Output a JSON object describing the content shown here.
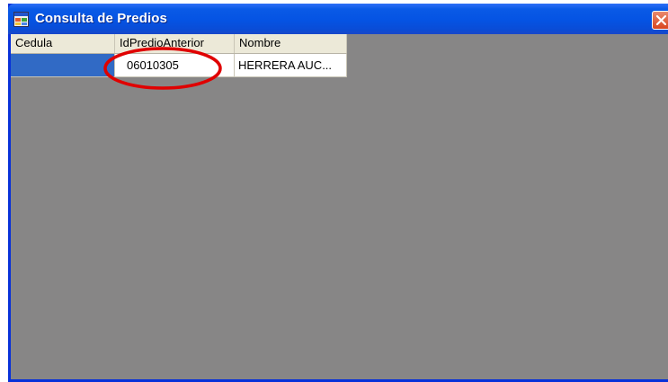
{
  "window": {
    "title": "Consulta de Predios",
    "app_icon": "form-icon",
    "close_icon": "close-icon"
  },
  "grid": {
    "columns": [
      "Cedula",
      "IdPredioAnterior",
      "Nombre"
    ],
    "rows": [
      {
        "cedula": "",
        "id_predio_anterior": "06010305",
        "nombre": "HERRERA AUC..."
      }
    ]
  },
  "colors": {
    "titlebar": "#0553e3",
    "client_background": "#878686",
    "selection": "#316ac5",
    "annotation": "#e00000"
  }
}
